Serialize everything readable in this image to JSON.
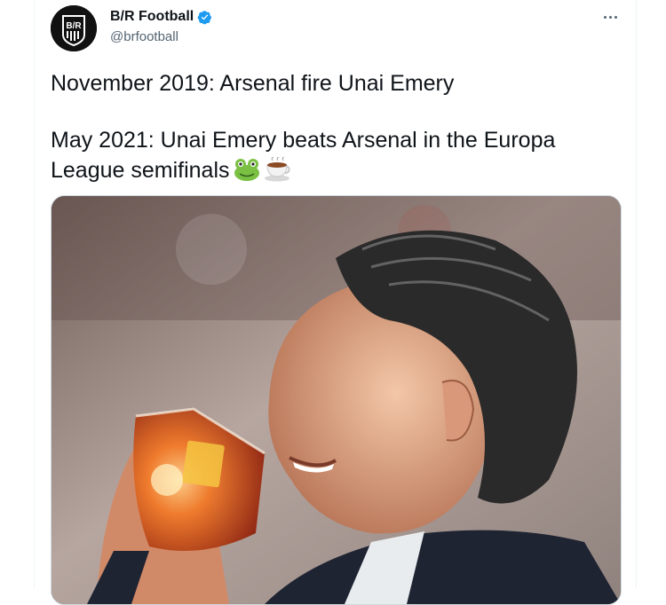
{
  "account": {
    "display_name": "B/R Football",
    "handle": "@brfootball",
    "verified": true,
    "avatar_icon": "br-logo-icon"
  },
  "menu": {
    "icon": "more-horizontal-icon"
  },
  "tweet": {
    "line1": "November 2019: Arsenal fire Unai Emery",
    "line2": "May 2021: Unai Emery beats Arsenal in the Europa League semifinals",
    "emojis": [
      "frog-emoji",
      "tea-emoji"
    ]
  },
  "media": {
    "type": "photo"
  },
  "colors": {
    "accent": "#1d9bf0",
    "text": "#0f1419",
    "muted": "#536471"
  }
}
